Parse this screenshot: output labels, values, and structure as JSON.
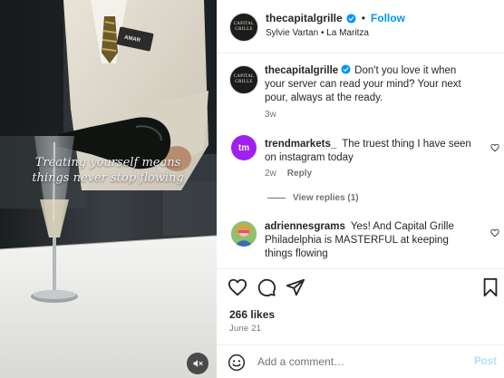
{
  "post": {
    "author": "thecapitalgrille",
    "follow_label": "Follow",
    "dot": "•",
    "audio": "Sylvie Vartan • La Maritza",
    "avatar_label": "CAPITAL GRILLE",
    "video_overlay": {
      "line1": "Treating yourself means",
      "line2": "things never stop flowing"
    },
    "caption": {
      "username": "thecapitalgrille",
      "text": "Don't you love it when your server can read your mind? Your next pour, always at the ready.",
      "time": "3w"
    }
  },
  "comments": [
    {
      "username": "trendmarkets_",
      "text": "The truest thing I have seen on instagram today",
      "time": "2w",
      "reply_label": "Reply",
      "avatar_label": "tm",
      "view_replies": "View replies (1)"
    },
    {
      "username": "adriennesgrams",
      "text": "Yes! And Capital Grille Philadelphia is MASTERFUL at keeping things flowing"
    }
  ],
  "stats": {
    "likes": "266 likes",
    "date": "June 21"
  },
  "composer": {
    "placeholder": "Add a comment…",
    "post_label": "Post"
  },
  "icons": {
    "verified": "verified-badge-icon",
    "more": "more-options-icon",
    "like": "heart-icon",
    "comment": "comment-icon",
    "share": "share-icon",
    "save": "bookmark-icon",
    "emoji": "emoji-icon",
    "mute": "muted-speaker-icon"
  },
  "colors": {
    "link_blue": "#0095f6",
    "post_disabled": "#b2dffc",
    "secondary_text": "#737373",
    "trendmarkets_avatar": "#a020f0"
  }
}
